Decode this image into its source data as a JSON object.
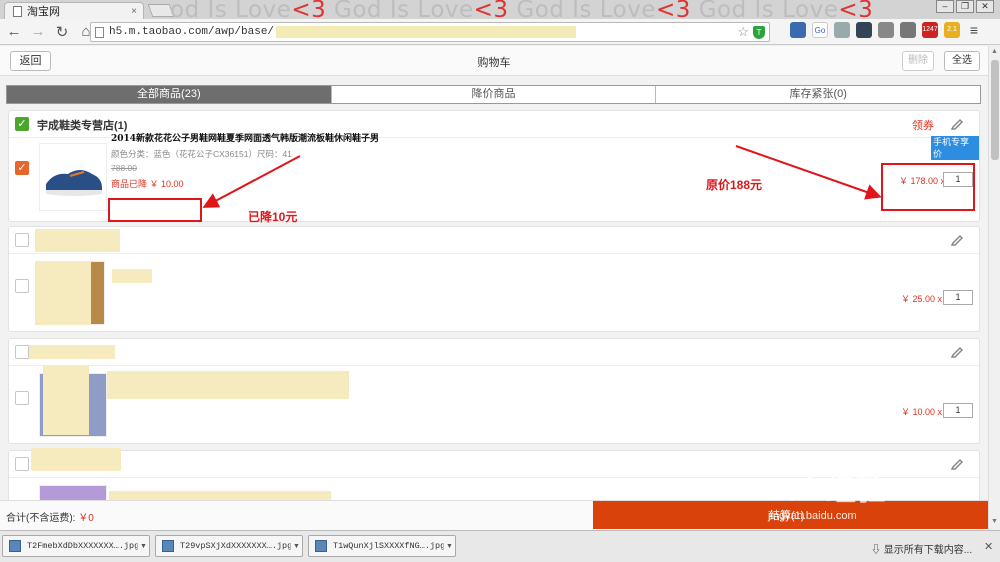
{
  "browser": {
    "tab_title": "淘宝网",
    "tab_close": "×",
    "watermark_parts": [
      "od Is Love",
      "<3",
      " God Is Love",
      "<3",
      " God Is Love",
      "<3",
      " God Is Love",
      "<3"
    ],
    "url_text": "h5.m.taobao.com/awp/base/",
    "shield_text": "T",
    "extension_badge": "1247",
    "extension_badge2": "2.1"
  },
  "header": {
    "back_label": "返回",
    "title": "购物车",
    "delete_label": "删除",
    "select_all_label": "全选"
  },
  "tabs": [
    {
      "label": "全部商品(23)",
      "active": true
    },
    {
      "label": "降价商品",
      "active": false
    },
    {
      "label": "库存紧张(0)",
      "active": false
    }
  ],
  "shop1": {
    "name": "宇成鞋类专营店(1)",
    "coupon_label": "领券",
    "mobile_badge": "手机专享价",
    "item": {
      "title": "2014新款花花公子男鞋网鞋夏季网面透气韩版潮流板鞋休闲鞋子男",
      "spec": "颜色分类：蓝色（花花公子CX36151）尺码：41",
      "original_price": "788.00",
      "price_drop": "商品已降 ￥ 10.00",
      "price": "￥ 178.00",
      "qty_prefix": "x",
      "qty": "1"
    }
  },
  "items": [
    {
      "price": "￥ 25.00",
      "qty_prefix": "x",
      "qty": "1"
    },
    {
      "price": "￥ 10.00",
      "qty_prefix": "x",
      "qty": "1"
    }
  ],
  "annotations": {
    "original_price_note": "原价188元",
    "dropped_note": "已降10元"
  },
  "footer": {
    "total_label": "合计(不含运费): ",
    "total_value": "￥0",
    "checkout_label": "结算(1)"
  },
  "downloads": [
    {
      "name": "T2FmebXdDbXXXXXXX….jpg"
    },
    {
      "name": "T29vpSXjXdXXXXXXX….jpg"
    },
    {
      "name": "T1wQunXjlSXXXXfNG….jpg"
    }
  ],
  "downloads_show_all": "显示所有下载内容...",
  "watermark": {
    "brand": "Bai  经验",
    "url": "jingyan.baidu.com"
  },
  "colors": {
    "accent_red": "#d32",
    "annotation_red": "#e0151a",
    "checkout_orange": "#d9420b",
    "checkbox_green": "#4ba62d",
    "checkbox_orange": "#e8662a"
  }
}
